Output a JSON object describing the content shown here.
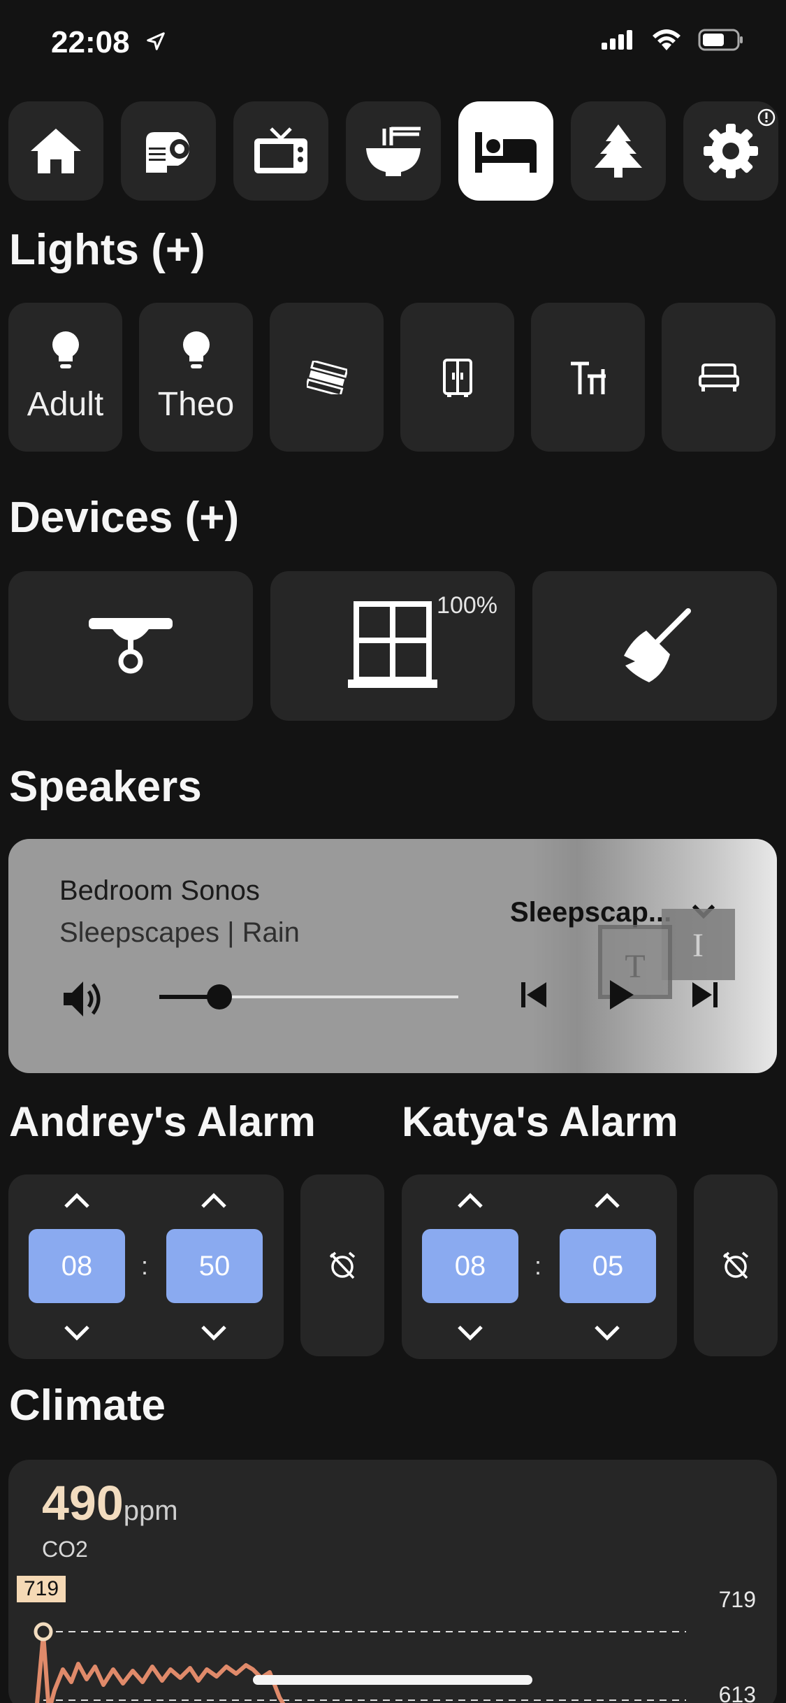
{
  "status_bar": {
    "time": "22:08"
  },
  "tabs": [
    {
      "icon": "home-icon"
    },
    {
      "icon": "projector-icon"
    },
    {
      "icon": "tv-icon"
    },
    {
      "icon": "noodle-bowl-icon"
    },
    {
      "icon": "bed-icon",
      "active": true
    },
    {
      "icon": "tree-icon"
    },
    {
      "icon": "gear-icon",
      "badge": "!"
    }
  ],
  "lights": {
    "title": "Lights (+)",
    "items": [
      {
        "label": "Adult",
        "icon": "bulb-icon"
      },
      {
        "label": "Theo",
        "icon": "bulb-icon"
      },
      {
        "label": "",
        "icon": "led-strip-icon"
      },
      {
        "label": "",
        "icon": "wardrobe-icon"
      },
      {
        "label": "",
        "icon": "desk-lamp-icon"
      },
      {
        "label": "",
        "icon": "bed-light-icon"
      }
    ]
  },
  "devices": {
    "title": "Devices (+)",
    "items": [
      {
        "icon": "ceiling-fan-icon",
        "value": ""
      },
      {
        "icon": "window-blinds-icon",
        "value": "100%"
      },
      {
        "icon": "broom-icon",
        "value": ""
      }
    ]
  },
  "speakers": {
    "title": "Speakers",
    "name": "Bedroom Sonos",
    "track": "Sleepscapes | Rain",
    "source": "Sleepscap...",
    "volume": 0.2
  },
  "alarms": [
    {
      "title": "Andrey's Alarm",
      "hour": "08",
      "minute": "50",
      "separator": ":"
    },
    {
      "title": "Katya's Alarm",
      "hour": "08",
      "minute": "05",
      "separator": ":"
    }
  ],
  "climate": {
    "title": "Climate",
    "value": "490",
    "unit": "ppm",
    "metric": "CO2",
    "max_badge": "719",
    "line_max_label": "719",
    "line_min_label": "613"
  },
  "colors": {
    "background": "#131313",
    "card": "#262626",
    "accent_blue": "#8aaaf0",
    "co2_line": "#e08a6a",
    "co2_value": "#f2dcbf"
  }
}
